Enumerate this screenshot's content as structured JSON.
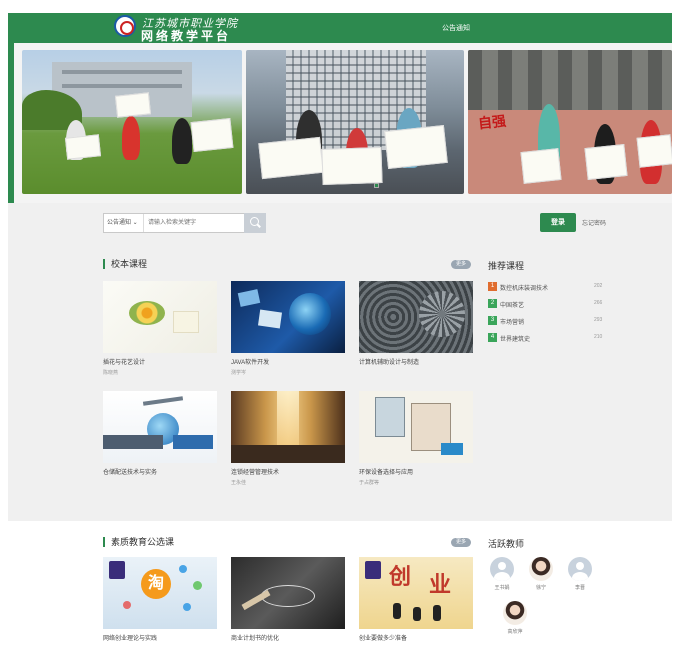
{
  "header": {
    "logo_text": "江苏城市职业学院",
    "subtitle": "网络教学平台",
    "notice_link": "公告通知"
  },
  "search": {
    "category": "公告通知 ⌄",
    "placeholder": "请输入检索关键字"
  },
  "auth": {
    "login": "登录",
    "register": "忘记密码"
  },
  "colors": {
    "brand_green": "#2d8a4f",
    "rec_orange": "#e06d2f",
    "rec_green": "#3aa55a"
  },
  "school_courses": {
    "title": "校本课程",
    "more": "更多",
    "items": [
      {
        "name": "插花与花艺设计",
        "teacher": "陈晓燕"
      },
      {
        "name": "JAVA软件开发",
        "teacher": "测学岑"
      },
      {
        "name": "计算机辅助设计与制造",
        "teacher": ""
      },
      {
        "name": "仓储配送技术与实务",
        "teacher": ""
      },
      {
        "name": "连锁经营管理技术",
        "teacher": "王永佳"
      },
      {
        "name": "环保设备选择与应用",
        "teacher": "于占群等"
      }
    ]
  },
  "recommended": {
    "title": "推荐课程",
    "items": [
      {
        "rank": "1",
        "name": "数控机床装调技术",
        "count": "202"
      },
      {
        "rank": "2",
        "name": "中国茶艺",
        "count": "266"
      },
      {
        "rank": "3",
        "name": "市场营销",
        "count": "293"
      },
      {
        "rank": "4",
        "name": "世界建筑史",
        "count": "210"
      }
    ]
  },
  "quality_courses": {
    "title": "素质教育公选课",
    "more": "更多",
    "items": [
      {
        "name": "网络创业理论与实践"
      },
      {
        "name": "商业计划书的优化"
      },
      {
        "name": "创业要做多少准备"
      }
    ]
  },
  "active_teachers": {
    "title": "活跃教师",
    "items": [
      {
        "name": "王书娟"
      },
      {
        "name": "徐宁"
      },
      {
        "name": "李晋"
      },
      {
        "name": "高欣萍"
      }
    ]
  }
}
